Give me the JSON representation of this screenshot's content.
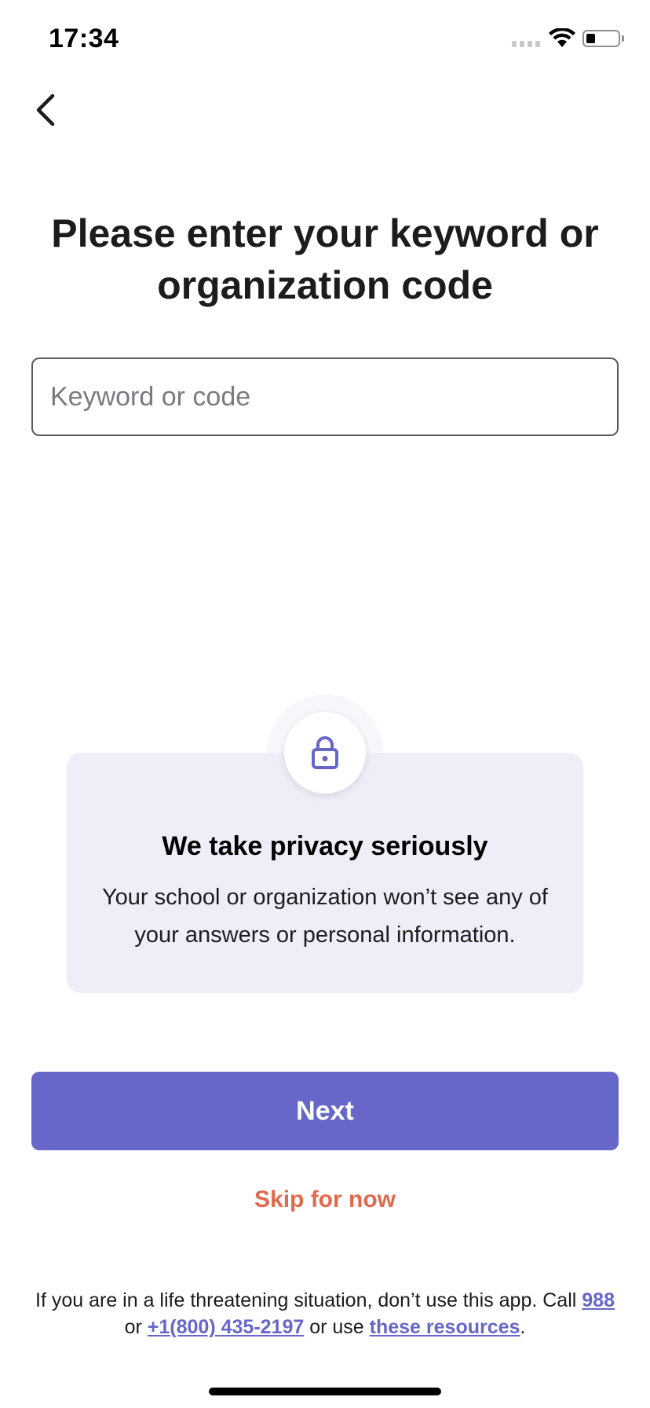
{
  "status_bar": {
    "time": "17:34",
    "battery_level": 0.3
  },
  "nav": {
    "back_icon": "chevron-left-icon"
  },
  "page": {
    "title": "Please enter your keyword or organization code"
  },
  "code_input": {
    "value": "",
    "placeholder": "Keyword or code"
  },
  "privacy": {
    "icon": "lock-icon",
    "title": "We take privacy seriously",
    "body": "Your school or organization won’t see any of your answers or personal information."
  },
  "actions": {
    "next_label": "Next",
    "skip_label": "Skip for now"
  },
  "disclaimer": {
    "prefix": "If you are in a life threatening situation, don’t use this app. Call",
    "link_988": "988",
    "or_1": "or",
    "link_phone": "+1(800) 435-2197",
    "or_2": "or use",
    "link_resources": "these resources",
    "suffix": "."
  },
  "colors": {
    "accent": "#6667c9",
    "skip": "#e06a4e",
    "card_bg": "#eeeef9"
  }
}
